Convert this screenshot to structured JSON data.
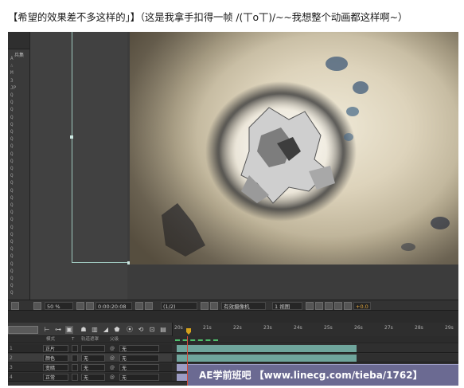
{
  "caption": "【希望的效果差不多这样的」】（这是我拿手扣得一帧 /(丅o丅)/~~我想整个动画都这样啊~）",
  "left_panel": {
    "header_tag": "兵集",
    "rows": [
      "A",
      "∴",
      "M",
      "3",
      "JP",
      "Q",
      "Q",
      "Q",
      "Q",
      "Q",
      "Q",
      "Q",
      "Q",
      "Q",
      "Q",
      "Q",
      "Q",
      "Q",
      "Q",
      "Q",
      "Q",
      "Q",
      "Q",
      "Q",
      "Q",
      "Q",
      "Q",
      "Q",
      "Q",
      "Q",
      "Q",
      "Q",
      "Q"
    ]
  },
  "viewer_status": {
    "zoom": "50 %",
    "timecode": "0:00:20:08",
    "resolution": "(1/2)",
    "camera": "有效摄像机",
    "views": "1 视图",
    "exposure": "+0.0"
  },
  "timeline": {
    "ruler_ticks": [
      "20s",
      "21s",
      "22s",
      "23s",
      "24s",
      "25s",
      "26s",
      "27s",
      "28s",
      "29s"
    ],
    "column_headers": {
      "mode": "模式",
      "t": "T",
      "trkmat": "轨道遮罩",
      "parent": "父级"
    },
    "layers": [
      {
        "index": "1",
        "mode": "正片",
        "trkmat": "",
        "parent": "无",
        "selected": false
      },
      {
        "index": "2",
        "mode": "颜色",
        "trkmat": "无",
        "parent": "无",
        "selected": true
      },
      {
        "index": "3",
        "mode": "变暗",
        "trkmat": "无",
        "parent": "无",
        "selected": false
      },
      {
        "index": "4",
        "mode": "正常",
        "trkmat": "无",
        "parent": "无",
        "selected": false
      }
    ]
  },
  "watermark": "AE学前班吧 【www.linecg.com/tieba/1762】",
  "colors": {
    "layer_bar_teal": "#6fa59c",
    "layer_bar_lavender": "#9c9cc4",
    "playhead": "#d14a3a",
    "guide_line": "#9fc8bf"
  }
}
